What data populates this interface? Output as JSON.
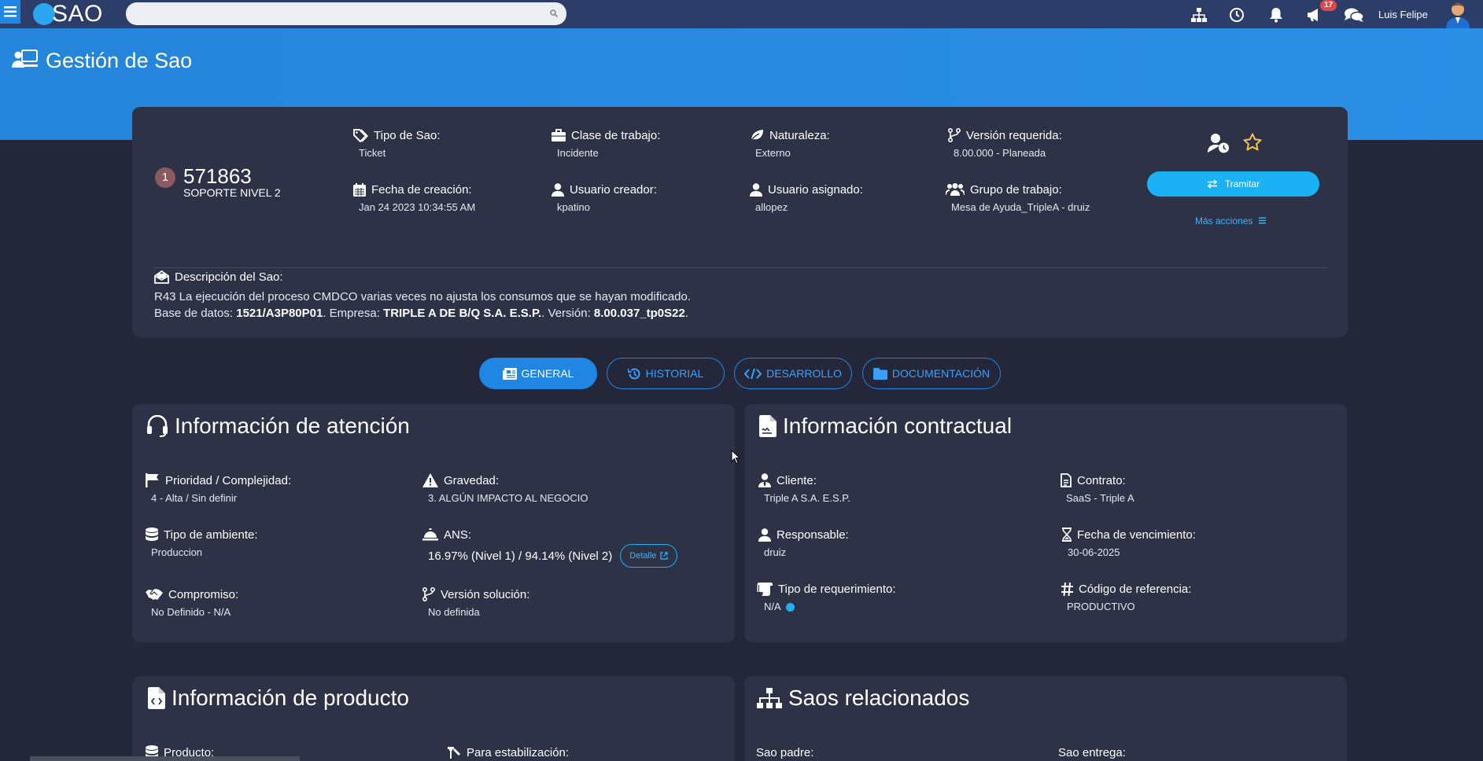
{
  "app": {
    "logo_text": "SAO",
    "search": {
      "placeholder": ""
    },
    "notifications_badge": "17",
    "user_name": "Luis Felipe"
  },
  "page": {
    "title": "Gestión de Sao"
  },
  "ticket": {
    "position": "1",
    "number": "571863",
    "level": "SOPORTE NIVEL 2",
    "fields": {
      "tipo_sao": {
        "label": "Tipo de Sao:",
        "value": "Ticket"
      },
      "clase_trabajo": {
        "label": "Clase de trabajo:",
        "value": "Incidente"
      },
      "naturaleza": {
        "label": "Naturaleza:",
        "value": "Externo"
      },
      "version_requerida": {
        "label": "Versión requerida:",
        "value": "8.00.000 - Planeada"
      },
      "fecha_creacion": {
        "label": "Fecha de creación:",
        "value": "Jan 24 2023 10:34:55 AM"
      },
      "usuario_creador": {
        "label": "Usuario creador:",
        "value": "kpatino"
      },
      "usuario_asignado": {
        "label": "Usuario asignado:",
        "value": "allopez"
      },
      "grupo_trabajo": {
        "label": "Grupo de trabajo:",
        "value": "Mesa de Ayuda_TripleA - druiz"
      }
    },
    "actions": {
      "tramitar": "Tramitar",
      "mas_acciones": "Más acciones"
    },
    "description": {
      "label": "Descripción del Sao:",
      "line1": "R43 La ejecución del proceso CMDCO varias veces no ajusta los consumos que se hayan modificado.",
      "db_prefix": "Base de datos: ",
      "db_value": "1521/A3P80P01",
      "company_prefix": ". Empresa: ",
      "company_value": "TRIPLE A DE B/Q S.A. E.S.P.",
      "version_prefix": ". Versión: ",
      "version_value": "8.00.037_tp0S22",
      "end": "."
    }
  },
  "tabs": [
    "GENERAL",
    "HISTORIAL",
    "DESARROLLO",
    "DOCUMENTACIÓN"
  ],
  "atencion": {
    "title": "Información de atención",
    "prioridad": {
      "label": "Prioridad / Complejidad:",
      "value": "4 - Alta / Sin definir"
    },
    "gravedad": {
      "label": "Gravedad:",
      "value": "3. ALGÚN IMPACTO AL NEGOCIO"
    },
    "ambiente": {
      "label": "Tipo de ambiente:",
      "value": "Produccion"
    },
    "ans": {
      "label": "ANS:",
      "value": "16.97% (Nivel 1) / 94.14% (Nivel 2)",
      "detalle": "Detalle"
    },
    "compromiso": {
      "label": "Compromiso:",
      "value": "No Definido - N/A"
    },
    "version_solucion": {
      "label": "Versión solución:",
      "value": "No definida"
    }
  },
  "contractual": {
    "title": "Información contractual",
    "cliente": {
      "label": "Cliente:",
      "value": "Triple A S.A. E.S.P."
    },
    "contrato": {
      "label": "Contrato:",
      "value": "SaaS - Triple A"
    },
    "responsable": {
      "label": "Responsable:",
      "value": "druiz"
    },
    "fecha_vencimiento": {
      "label": "Fecha de vencimiento:",
      "value": "30-06-2025"
    },
    "tipo_requerimiento": {
      "label": "Tipo de requerimiento:",
      "value": "N/A"
    },
    "codigo_referencia": {
      "label": "Código de referencia:",
      "value": "PRODUCTIVO"
    }
  },
  "producto": {
    "title": "Información de producto",
    "producto_label": "Producto:",
    "estabilizacion_label": "Para estabilización:"
  },
  "relacionados": {
    "title": "Saos relacionados",
    "padre_label": "Sao padre:",
    "entrega_label": "Sao entrega:"
  },
  "colors": {
    "accent": "#1f86e3",
    "topbar": "#2c3d6a",
    "card": "#2e3246",
    "background": "#24273a",
    "link": "#3ab5ff"
  }
}
